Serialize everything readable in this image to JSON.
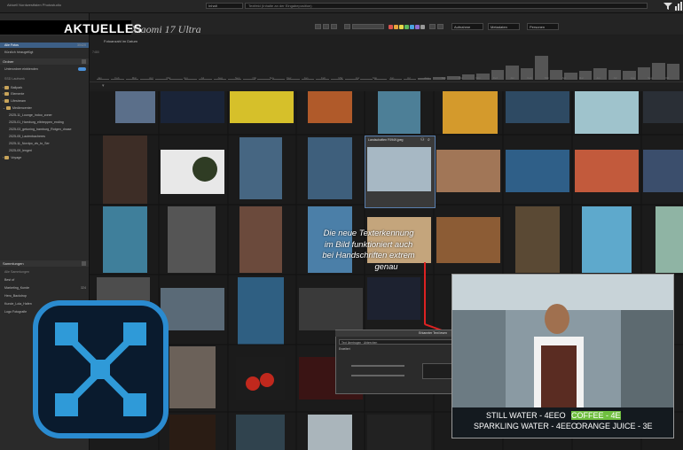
{
  "app": {
    "title": "Aktuell Nordwestfalen Photostudio"
  },
  "search": {
    "scope": "Inhalt",
    "placeholder": "Textfeld (Inhalte an der Eingabeposition)"
  },
  "headline": {
    "kicker": "AKTUELLES",
    "subject": "Xiaomi 17 Ultra"
  },
  "sidebar": {
    "sources_title": "Datenbank",
    "all_photos": {
      "label": "Alle Fotos",
      "count": "30420"
    },
    "recently_imported": "Kürzlich hinzugefügt",
    "folders_title": "Ordner",
    "show_subfolders": "Unterordner einblenden",
    "disk_label": "SSD Laufwerk",
    "folders": [
      {
        "label": "Ballpark"
      },
      {
        "label": "Elemente"
      },
      {
        "label": "Lifestream"
      },
      {
        "label": "Mediencenter"
      }
    ],
    "subfolders": [
      {
        "label": "2025-11_Lounge_indoo_zoner"
      },
      {
        "label": "2025-01_Hamburg_elbtreppen_ending"
      },
      {
        "label": "2025-03_getuning_hamburg_Rotgen_dnase"
      },
      {
        "label": "2025-05_Lautenbacheres"
      },
      {
        "label": "2025-11_Nordpo_vis_to_Ser"
      },
      {
        "label": "2025-09_lengeri"
      }
    ],
    "extra_folder": "Voyage",
    "collections_title": "Sammlungen",
    "collections_sub": "Alle Sammlungen",
    "collections": [
      {
        "label": "Best of"
      },
      {
        "label": "Marketing_Kunde",
        "count": "324"
      },
      {
        "label": "Hero_Backdrop"
      },
      {
        "label": "Kunde_Lola_Hafen"
      },
      {
        "label": "Logo Fotografie"
      }
    ]
  },
  "toolbar": {
    "sort": "Aufnahme",
    "metadata": "Metadaten",
    "filter": "Personen",
    "colors": [
      "#d9534f",
      "#e8a33c",
      "#e6d84a",
      "#5cb85c",
      "#4aa3df",
      "#8e6dd1",
      "#999999"
    ]
  },
  "timeline": {
    "title": "Fotoanzahl im Datum",
    "max_label": "7480",
    "months": [
      "Jan",
      "Feb",
      "Mär",
      "Apr",
      "Mai",
      "Jun",
      "Jul",
      "Aug",
      "Sep",
      "Okt",
      "Nov",
      "Dez",
      "Jan",
      "Feb",
      "Mär",
      "Apr",
      "Mai",
      "Jun",
      "Jul",
      "Aug",
      "Sep",
      "Okt",
      "Nov",
      "Dez",
      "Jan",
      "Feb",
      "Mär",
      "Apr",
      "Mai",
      "Jun",
      "Jul",
      "Aug",
      "Sep",
      "Okt"
    ],
    "levels": [
      0.02,
      0.02,
      0.02,
      0.03,
      0.02,
      0.02,
      0.03,
      0.02,
      0.02,
      0.03,
      0.03,
      0.02,
      0.02,
      0.03,
      0.02,
      0.03,
      0.03,
      0.03,
      0.02,
      0.02,
      0.03,
      0.04,
      0.05,
      0.08,
      0.12,
      0.18,
      0.22,
      0.35,
      0.5,
      0.42,
      0.85,
      0.33,
      0.25,
      0.3,
      0.4,
      0.35,
      0.3,
      0.45,
      0.6,
      0.55
    ]
  },
  "hover_card": {
    "filename": "Landschaften F0949.jpeg"
  },
  "annotation": {
    "line1": "Die neue Texterkennung",
    "line2": "im Bild funktioniert auch",
    "line3": "bei Handschriften extrem",
    "line4": "genau"
  },
  "dialog": {
    "title": "Erkannter Text lesen",
    "field1": "Text übertragen",
    "field2": "Abbrechen",
    "field3": "Erweitert"
  },
  "photo_text": {
    "line1": "STILL WATER - 4EEO",
    "line2": "SPARKLING WATER - 4EEO",
    "line3": "COFFEE - 4E",
    "line4": "ORANGE JUICE - 3E"
  }
}
